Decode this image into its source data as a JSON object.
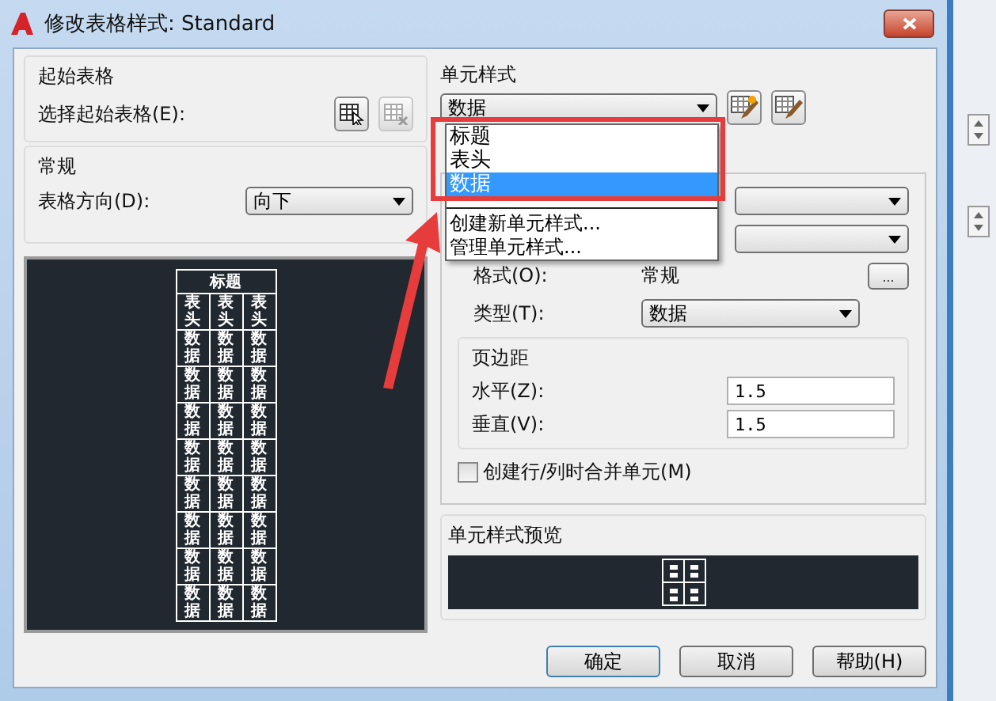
{
  "window": {
    "title": "修改表格样式: Standard"
  },
  "starting_table": {
    "title": "起始表格",
    "label": "选择起始表格(E):"
  },
  "general": {
    "title": "常规",
    "direction_label": "表格方向(D):",
    "direction_value": "向下"
  },
  "table_preview": {
    "title": "标题",
    "header": [
      "表头",
      "表头",
      "表头"
    ],
    "rows": [
      [
        "数据",
        "数据",
        "数据"
      ],
      [
        "数据",
        "数据",
        "数据"
      ],
      [
        "数据",
        "数据",
        "数据"
      ],
      [
        "数据",
        "数据",
        "数据"
      ],
      [
        "数据",
        "数据",
        "数据"
      ],
      [
        "数据",
        "数据",
        "数据"
      ],
      [
        "数据",
        "数据",
        "数据"
      ],
      [
        "数据",
        "数据",
        "数据"
      ]
    ]
  },
  "cell_style": {
    "label": "单元样式",
    "value": "数据",
    "dropdown": {
      "items": [
        {
          "label": "标题",
          "selected": false
        },
        {
          "label": "表头",
          "selected": false
        },
        {
          "label": "数据",
          "selected": true
        }
      ],
      "actions": [
        "创建新单元样式...",
        "管理单元样式..."
      ]
    }
  },
  "properties": {
    "format_label": "格式(O):",
    "format_value": "常规",
    "format_button": "...",
    "type_label": "类型(T):",
    "type_value": "数据"
  },
  "margins": {
    "title": "页边距",
    "fields": [
      {
        "label": "水平(Z):",
        "value": "1.5"
      },
      {
        "label": "垂直(V):",
        "value": "1.5"
      }
    ]
  },
  "merge_checkbox": {
    "label": "创建行/列时合并单元(M)",
    "checked": false
  },
  "cell_preview": {
    "title": "单元样式预览"
  },
  "buttons": [
    "确定",
    "取消",
    "帮助(H)"
  ]
}
